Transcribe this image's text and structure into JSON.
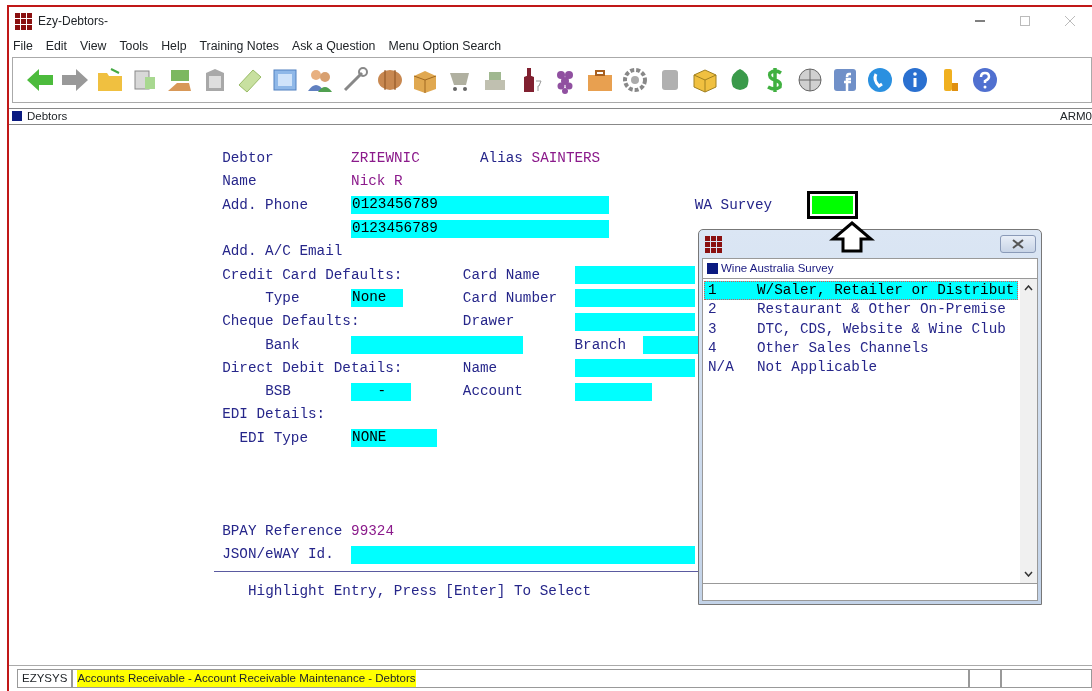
{
  "window": {
    "title": "Ezy-Debtors-"
  },
  "menu": [
    "File",
    "Edit",
    "View",
    "Tools",
    "Help",
    "Training Notes",
    "Ask a Question",
    "Menu Option Search"
  ],
  "tab_strip": {
    "tab": "Debtors",
    "code": "ARM0"
  },
  "form": {
    "rows": [
      {
        "cells": [
          {
            "kind": "label",
            "text": "Debtor"
          },
          {
            "kind": "value",
            "text": "ZRIEWNIC"
          },
          {
            "kind": "label",
            "text": "Alias"
          },
          {
            "kind": "value",
            "text": "SAINTERS"
          }
        ]
      },
      {
        "cells": [
          {
            "kind": "label",
            "text": "Name"
          },
          {
            "kind": "value",
            "text": "Nick R"
          }
        ]
      },
      {
        "cells": [
          {
            "kind": "label",
            "text": "Add. Phone"
          },
          {
            "kind": "field",
            "value": "0123456789"
          },
          {
            "kind": "label",
            "text": "WA Survey"
          },
          {
            "kind": "indicator",
            "color": "#00ff00"
          }
        ]
      },
      {
        "cells": [
          {
            "kind": "field",
            "value": "0123456789"
          }
        ]
      },
      {
        "cells": [
          {
            "kind": "label",
            "text": "Add. A/C Email"
          }
        ]
      },
      {
        "cells": [
          {
            "kind": "label",
            "text": "Credit Card Defaults:"
          },
          {
            "kind": "label",
            "text": "Card Name"
          },
          {
            "kind": "field"
          }
        ]
      },
      {
        "cells": [
          {
            "kind": "label",
            "text": "Type"
          },
          {
            "kind": "field",
            "value": "None"
          },
          {
            "kind": "label",
            "text": "Card Number"
          },
          {
            "kind": "field"
          }
        ]
      },
      {
        "cells": [
          {
            "kind": "label",
            "text": "Cheque Defaults:"
          },
          {
            "kind": "label",
            "text": "Drawer"
          },
          {
            "kind": "field"
          }
        ]
      },
      {
        "cells": [
          {
            "kind": "label",
            "text": "Bank"
          },
          {
            "kind": "field"
          },
          {
            "kind": "label",
            "text": "Branch"
          },
          {
            "kind": "field"
          }
        ]
      },
      {
        "cells": [
          {
            "kind": "label",
            "text": "Direct Debit Details:"
          },
          {
            "kind": "label",
            "text": "Name"
          },
          {
            "kind": "field"
          }
        ]
      },
      {
        "cells": [
          {
            "kind": "label",
            "text": "BSB"
          },
          {
            "kind": "field",
            "value": "-"
          },
          {
            "kind": "label",
            "text": "Account"
          },
          {
            "kind": "field"
          }
        ]
      },
      {
        "cells": [
          {
            "kind": "label",
            "text": "EDI Details:"
          }
        ]
      },
      {
        "cells": [
          {
            "kind": "label",
            "text": "EDI Type"
          },
          {
            "kind": "field",
            "value": "NONE"
          }
        ]
      },
      {
        "cells": [
          {
            "kind": "label",
            "text": "BPAY Reference"
          },
          {
            "kind": "value",
            "text": "99324"
          }
        ]
      },
      {
        "cells": [
          {
            "kind": "label",
            "text": "JSON/eWAY Id."
          },
          {
            "kind": "field"
          }
        ]
      }
    ],
    "hint": "Highlight Entry, Press [Enter] To Select"
  },
  "popup": {
    "caption": "Wine Australia Survey",
    "items": [
      {
        "code": "1",
        "label": "W/Saler, Retailer or Distribut",
        "selected": true
      },
      {
        "code": "2",
        "label": "Restaurant & Other On-Premise",
        "selected": false
      },
      {
        "code": "3",
        "label": "DTC, CDS, Website & Wine Club",
        "selected": false
      },
      {
        "code": "4",
        "label": "Other Sales Channels",
        "selected": false
      },
      {
        "code": "N/A",
        "label": "Not Applicable",
        "selected": false
      }
    ]
  },
  "status_bar": {
    "user": "EZYSYS",
    "path": "Accounts Receivable - Account Receivable Maintenance - Debtors"
  }
}
